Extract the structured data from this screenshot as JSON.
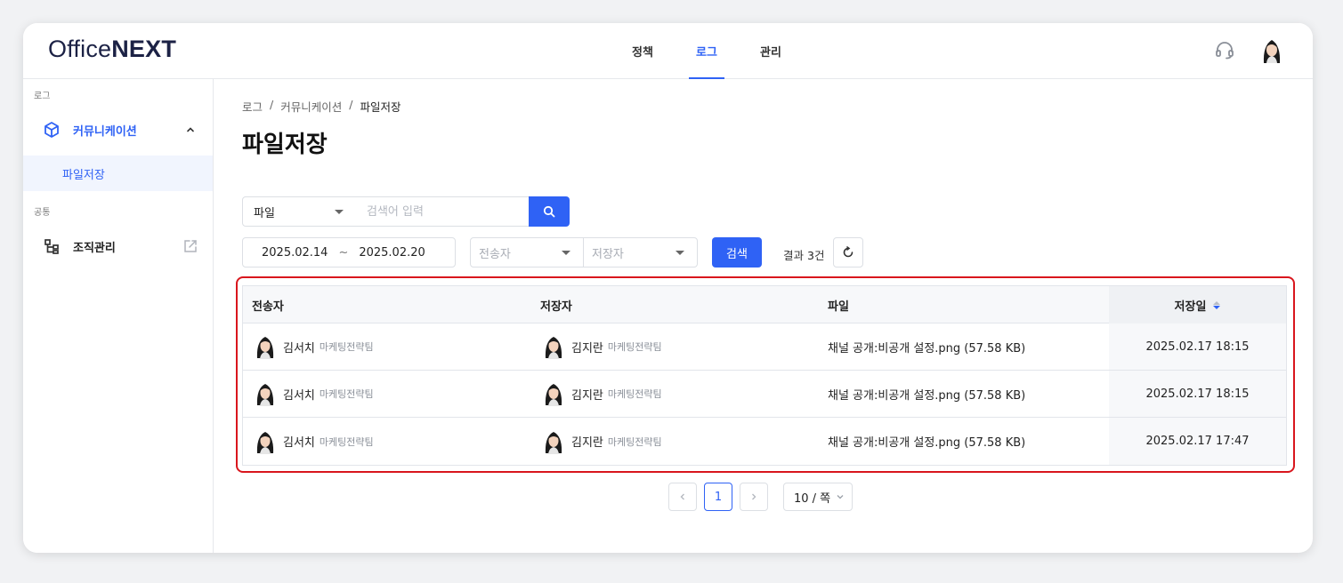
{
  "app": {
    "logo_office": "Office",
    "logo_next": "NEXT"
  },
  "topnav": {
    "items": [
      {
        "label": "정책"
      },
      {
        "label": "로그"
      },
      {
        "label": "관리"
      }
    ],
    "active": "로그"
  },
  "sidebar": {
    "section_log": "로그",
    "communication": "커뮤니케이션",
    "file_storage": "파일저장",
    "section_common": "공통",
    "org_management": "조직관리"
  },
  "breadcrumb": {
    "items": [
      "로그",
      "커뮤니케이션",
      "파일저장"
    ],
    "separator": "/"
  },
  "page": {
    "title": "파일저장"
  },
  "filters": {
    "type_select": "파일",
    "search_placeholder": "검색어 입력",
    "date_from": "2025.02.14",
    "date_sep": "~",
    "date_to": "2025.02.20",
    "sender_placeholder": "전송자",
    "saver_placeholder": "저장자",
    "search_button": "검색",
    "result_prefix": "결과",
    "result_count": "3",
    "result_suffix": "건"
  },
  "table": {
    "columns": [
      "전송자",
      "저장자",
      "파일",
      "저장일"
    ],
    "rows": [
      {
        "sender": "김서치",
        "sender_team": "마케팅전략팀",
        "saver": "김지란",
        "saver_team": "마케팅전략팀",
        "file": "채널 공개:비공개 설정.png (57.58 KB)",
        "date": "2025.02.17 18:15"
      },
      {
        "sender": "김서치",
        "sender_team": "마케팅전략팀",
        "saver": "김지란",
        "saver_team": "마케팅전략팀",
        "file": "채널 공개:비공개 설정.png (57.58 KB)",
        "date": "2025.02.17 18:15"
      },
      {
        "sender": "김서치",
        "sender_team": "마케팅전략팀",
        "saver": "김지란",
        "saver_team": "마케팅전략팀",
        "file": "채널 공개:비공개 설정.png (57.58 KB)",
        "date": "2025.02.17 17:47"
      }
    ]
  },
  "pagination": {
    "current_page": "1",
    "page_size": "10 / 쪽"
  },
  "colors": {
    "accent": "#2f62f5",
    "highlight": "#d9161d"
  },
  "icons": {
    "headset": "headset-icon",
    "search": "search-icon",
    "refresh": "refresh-icon",
    "cube": "cube-icon",
    "org": "org-chart-icon",
    "external": "external-link-icon"
  }
}
